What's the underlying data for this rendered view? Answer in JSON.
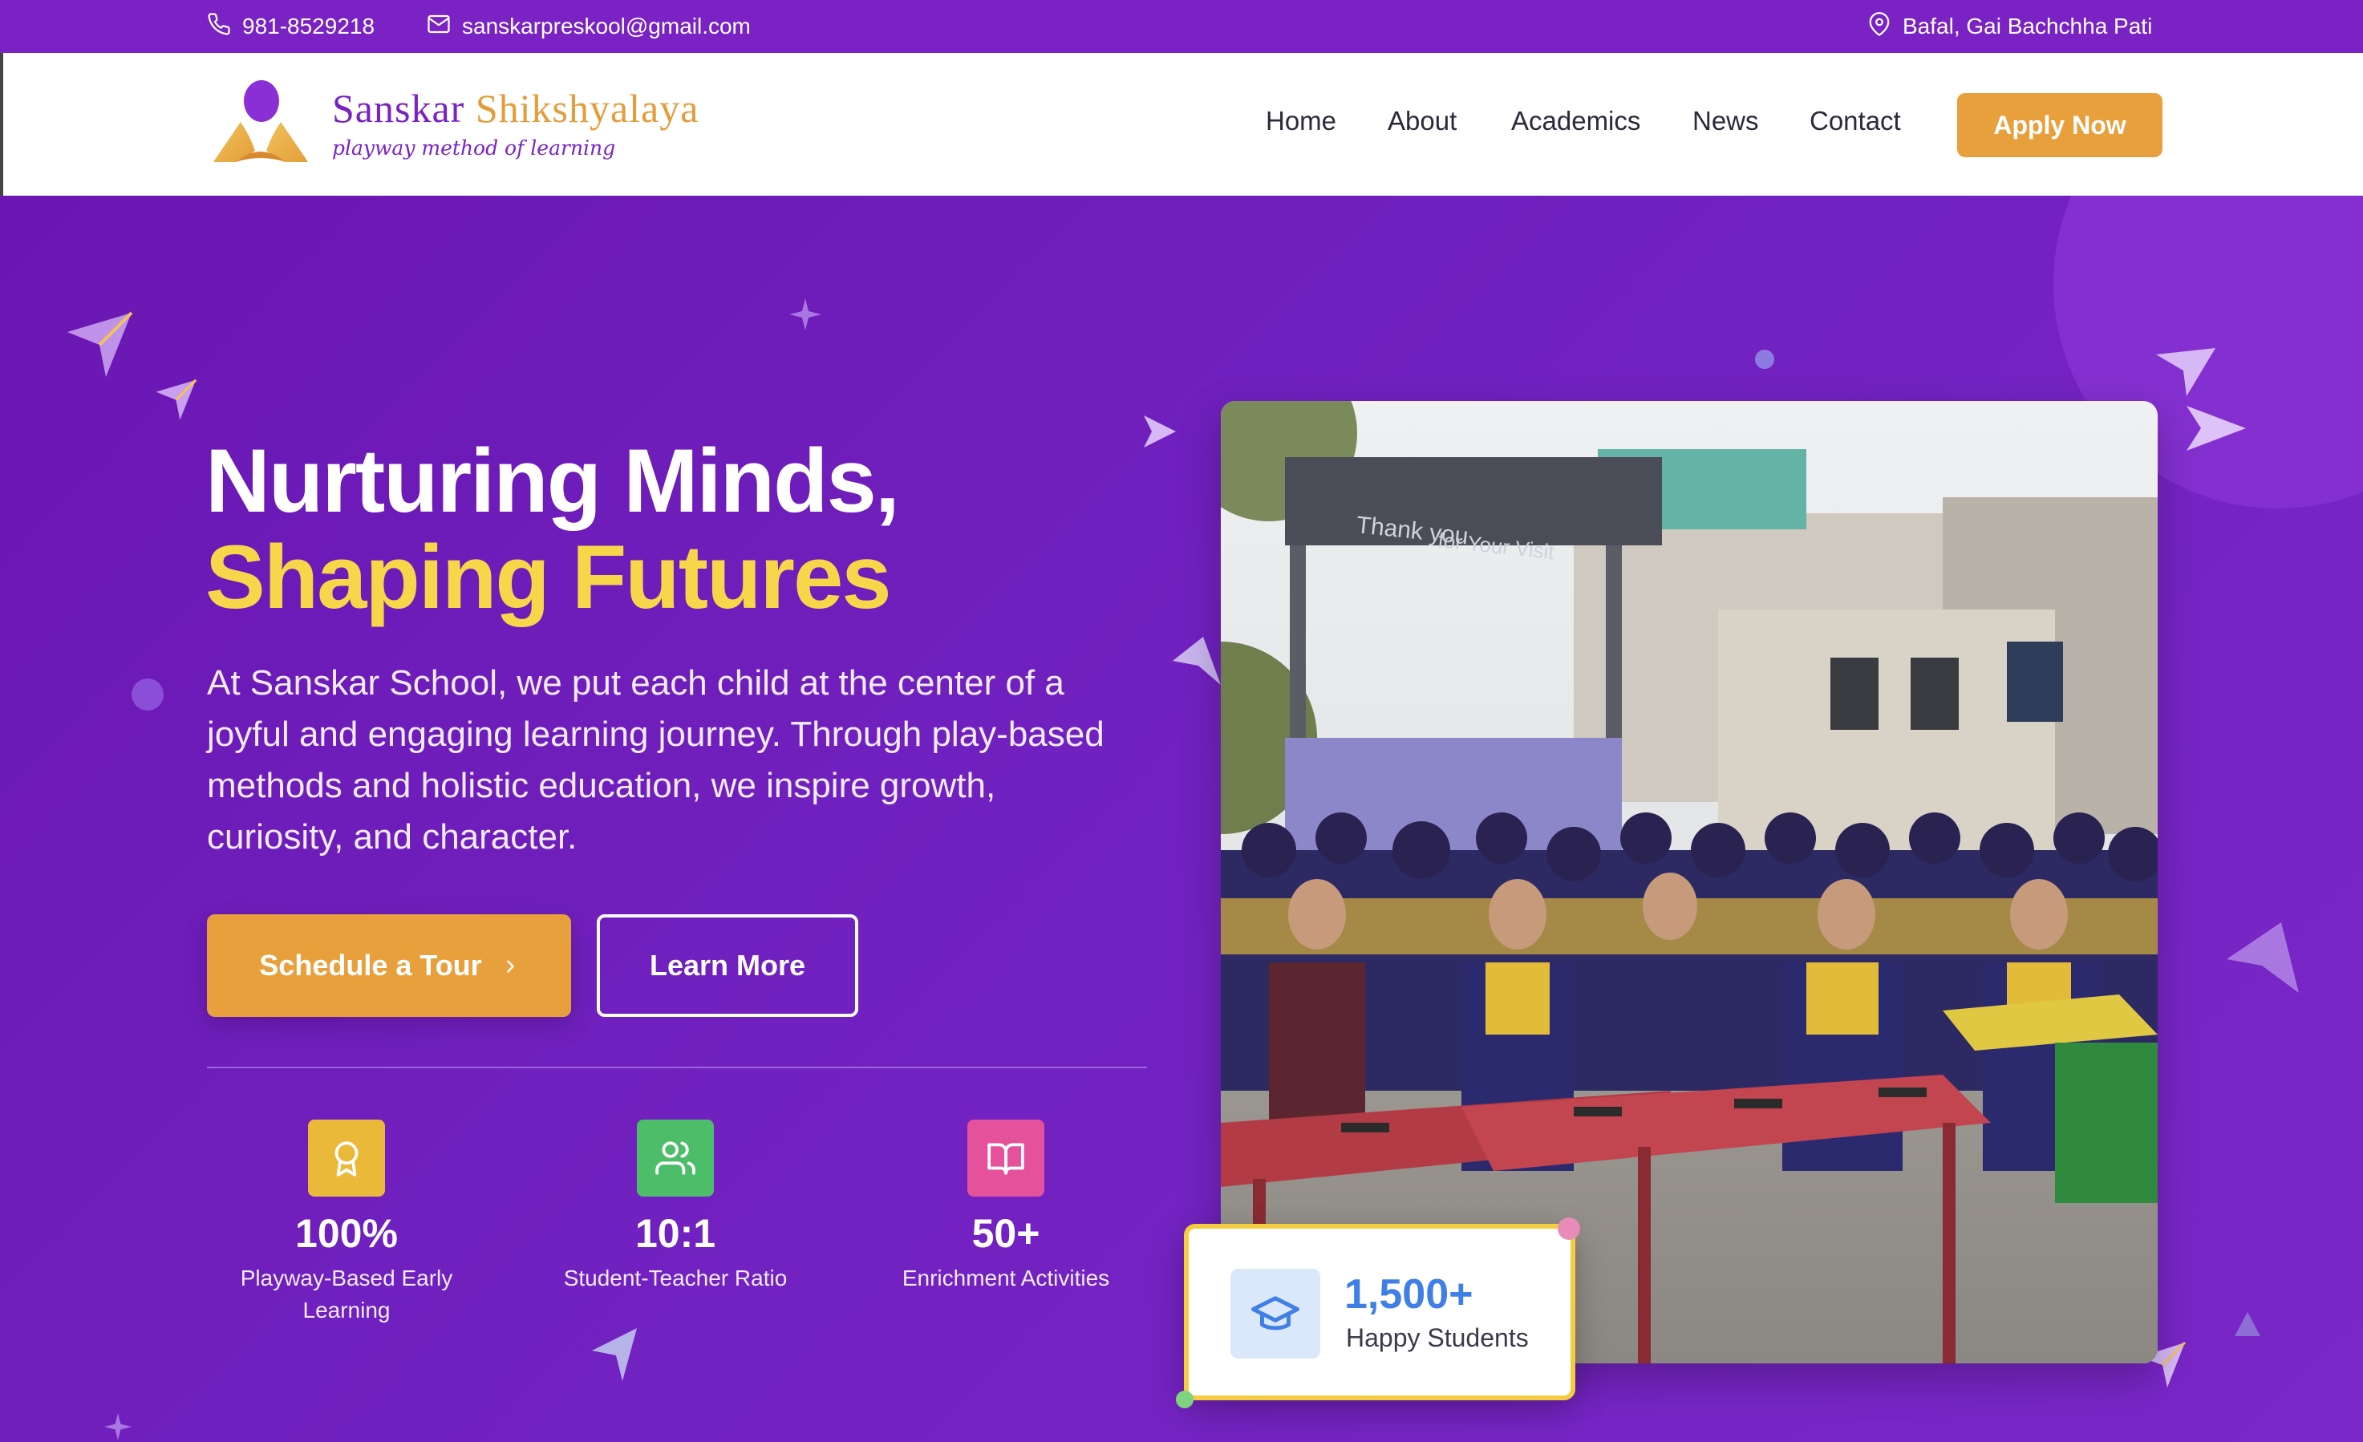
{
  "colors": {
    "brand_purple": "#7a22c4",
    "accent_orange": "#e8a03d",
    "headline_yellow": "#f7d649",
    "counter_blue": "#3f7fe6"
  },
  "topbar": {
    "phone_icon": "phone-icon",
    "phone": "981-8529218",
    "email_icon": "mail-icon",
    "email": "sanskarpreskool@gmail.com",
    "location_icon": "map-pin-icon",
    "location": "Bafal, Gai Bachchha Pati"
  },
  "header": {
    "brand_first": "Sanskar",
    "brand_second": "Shikshyalaya",
    "tagline": "playway method of learning",
    "nav": [
      "Home",
      "About",
      "Academics",
      "News",
      "Contact"
    ],
    "cta": "Apply Now"
  },
  "hero": {
    "headline_line1": "Nurturing Minds,",
    "headline_line2": "Shaping Futures",
    "description": "At Sanskar School, we put each child at the center of a joyful and engaging learning journey. Through play-based methods and holistic education, we inspire growth, curiosity, and character.",
    "primary_button": "Schedule a Tour",
    "secondary_button": "Learn More",
    "stats": [
      {
        "icon": "award-icon",
        "color": "#ebb93a",
        "value": "100%",
        "label": "Playway-Based Early Learning"
      },
      {
        "icon": "users-icon",
        "color": "#4dbd6a",
        "value": "10:1",
        "label": "Student-Teacher Ratio"
      },
      {
        "icon": "book-open-icon",
        "color": "#e6519b",
        "value": "50+",
        "label": "Enrichment Activities"
      }
    ],
    "photo_banner": [
      "Thank you",
      "for Your Visit"
    ],
    "counter": {
      "icon": "graduation-cap-icon",
      "value": "1,500+",
      "label": "Happy Students"
    }
  }
}
